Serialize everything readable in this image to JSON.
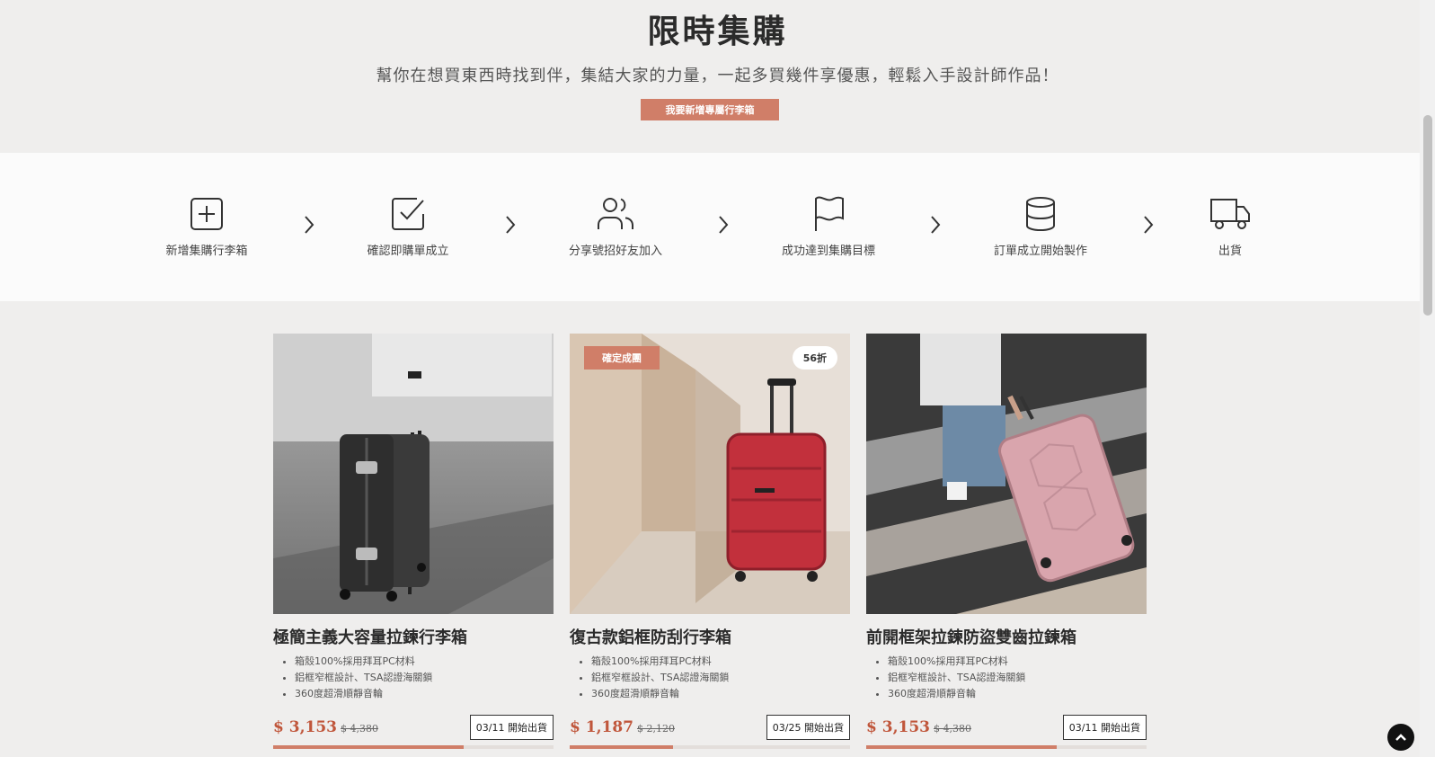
{
  "hero": {
    "title": "限時集購",
    "subtitle": "幫你在想買東西時找到伴，集結大家的力量，一起多買幾件享優惠，輕鬆入手設計師作品！",
    "cta_label": "我要新增專屬行李箱"
  },
  "steps": [
    {
      "label": "新增集購行李箱",
      "icon": "plus-square-icon"
    },
    {
      "label": "確認即購單成立",
      "icon": "check-square-icon"
    },
    {
      "label": "分享號招好友加入",
      "icon": "users-icon"
    },
    {
      "label": "成功達到集購目標",
      "icon": "flag-icon"
    },
    {
      "label": "訂單成立開始製作",
      "icon": "database-icon"
    },
    {
      "label": "出貨",
      "icon": "truck-icon"
    }
  ],
  "products": [
    {
      "title": "極簡主義大容量拉鍊行李箱",
      "features": [
        "箱殼100%採用拜耳PC材料",
        "鋁框窄框設計、TSA認證海關鎖",
        "360度超滑順靜音輪"
      ],
      "price": "$ 3,153",
      "old_price": "$ 4,380",
      "ship": "03/11 開始出貨",
      "progress": 0.68
    },
    {
      "title": "復古款鋁框防刮行李箱",
      "features": [
        "箱殼100%採用拜耳PC材料",
        "鋁框窄框設計、TSA認證海關鎖",
        "360度超滑順靜音輪"
      ],
      "price": "$ 1,187",
      "old_price": "$ 2,120",
      "ship": "03/25 開始出貨",
      "progress": 0.37,
      "tag": "確定成團",
      "discount": "56折"
    },
    {
      "title": "前開框架拉鍊防盜雙齒拉鍊箱",
      "features": [
        "箱殼100%採用拜耳PC材料",
        "鋁框窄框設計、TSA認證海關鎖",
        "360度超滑順靜音輪"
      ],
      "price": "$ 3,153",
      "old_price": "$ 4,380",
      "ship": "03/11 開始出貨",
      "progress": 0.68
    }
  ],
  "colors": {
    "accent": "#d07e68",
    "price": "#c0563b",
    "background": "#efeeed",
    "band": "#fbfbfb"
  }
}
